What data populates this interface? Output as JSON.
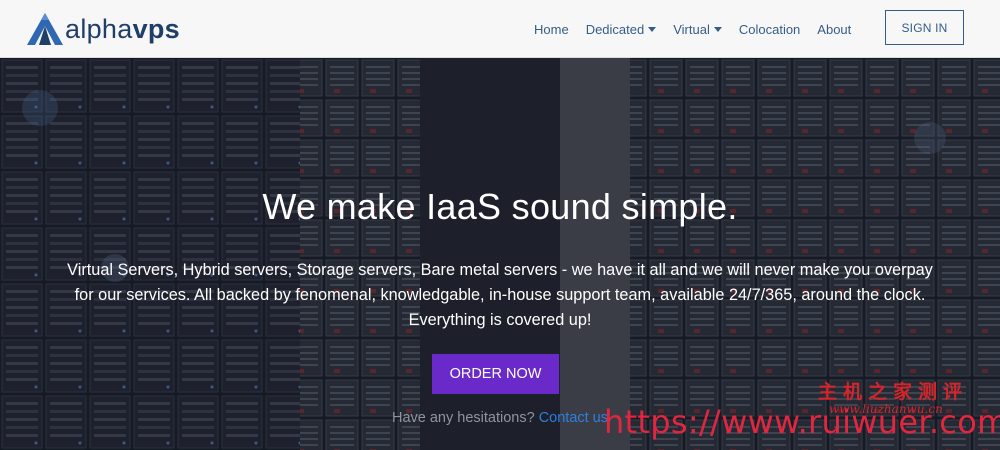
{
  "brand": {
    "name_light": "alpha",
    "name_bold": "vps",
    "logo_color": "#2f67b1"
  },
  "nav": {
    "items": [
      {
        "label": "Home",
        "dropdown": false
      },
      {
        "label": "Dedicated",
        "dropdown": true
      },
      {
        "label": "Virtual",
        "dropdown": true
      },
      {
        "label": "Colocation",
        "dropdown": false
      },
      {
        "label": "About",
        "dropdown": false
      }
    ],
    "signin_label": "SIGN IN"
  },
  "hero": {
    "title": "We make IaaS sound simple.",
    "description_lines": [
      "Virtual Servers, Hybrid servers, Storage servers, Bare metal servers - we have it all and we will never make you overpay",
      "for our services. All backed by fenomenal, knowledgable, in-house support team, available 24/7/365, around the clock.",
      "Everything is covered up!"
    ],
    "cta_label": "ORDER NOW",
    "hesitation_text": "Have any hesitations?",
    "contact_link": "Contact us"
  },
  "watermark": {
    "chinese": "主机之家测评",
    "sub": "www.liuzhanwu.cn",
    "url": "https://www.ruiwuer.com"
  },
  "colors": {
    "accent": "#6a2ac9",
    "nav_text": "#355d86",
    "link": "#2e7fe0",
    "watermark": "#d4252b"
  }
}
